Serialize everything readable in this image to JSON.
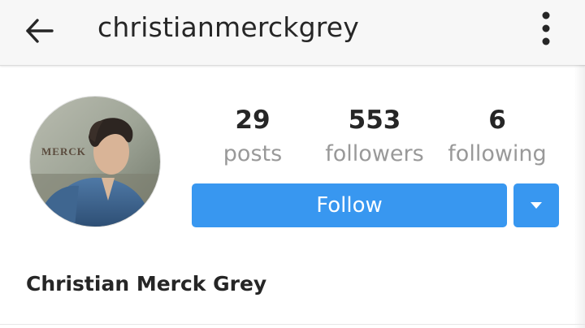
{
  "header": {
    "username": "christianmerckgrey",
    "back_icon": "arrow-left-icon",
    "menu_icon": "more-vertical-icon"
  },
  "profile": {
    "full_name": "Christian Merck Grey",
    "avatar_watermark": "MERCK"
  },
  "stats": {
    "posts": {
      "value": "29",
      "label": "posts"
    },
    "followers": {
      "value": "553",
      "label": "followers"
    },
    "following": {
      "value": "6",
      "label": "following"
    }
  },
  "actions": {
    "follow_label": "Follow",
    "dropdown_icon": "caret-down-icon"
  },
  "colors": {
    "accent": "#3897f0",
    "text": "#262626",
    "muted": "#999999",
    "header_bg": "#f7f7f7"
  }
}
